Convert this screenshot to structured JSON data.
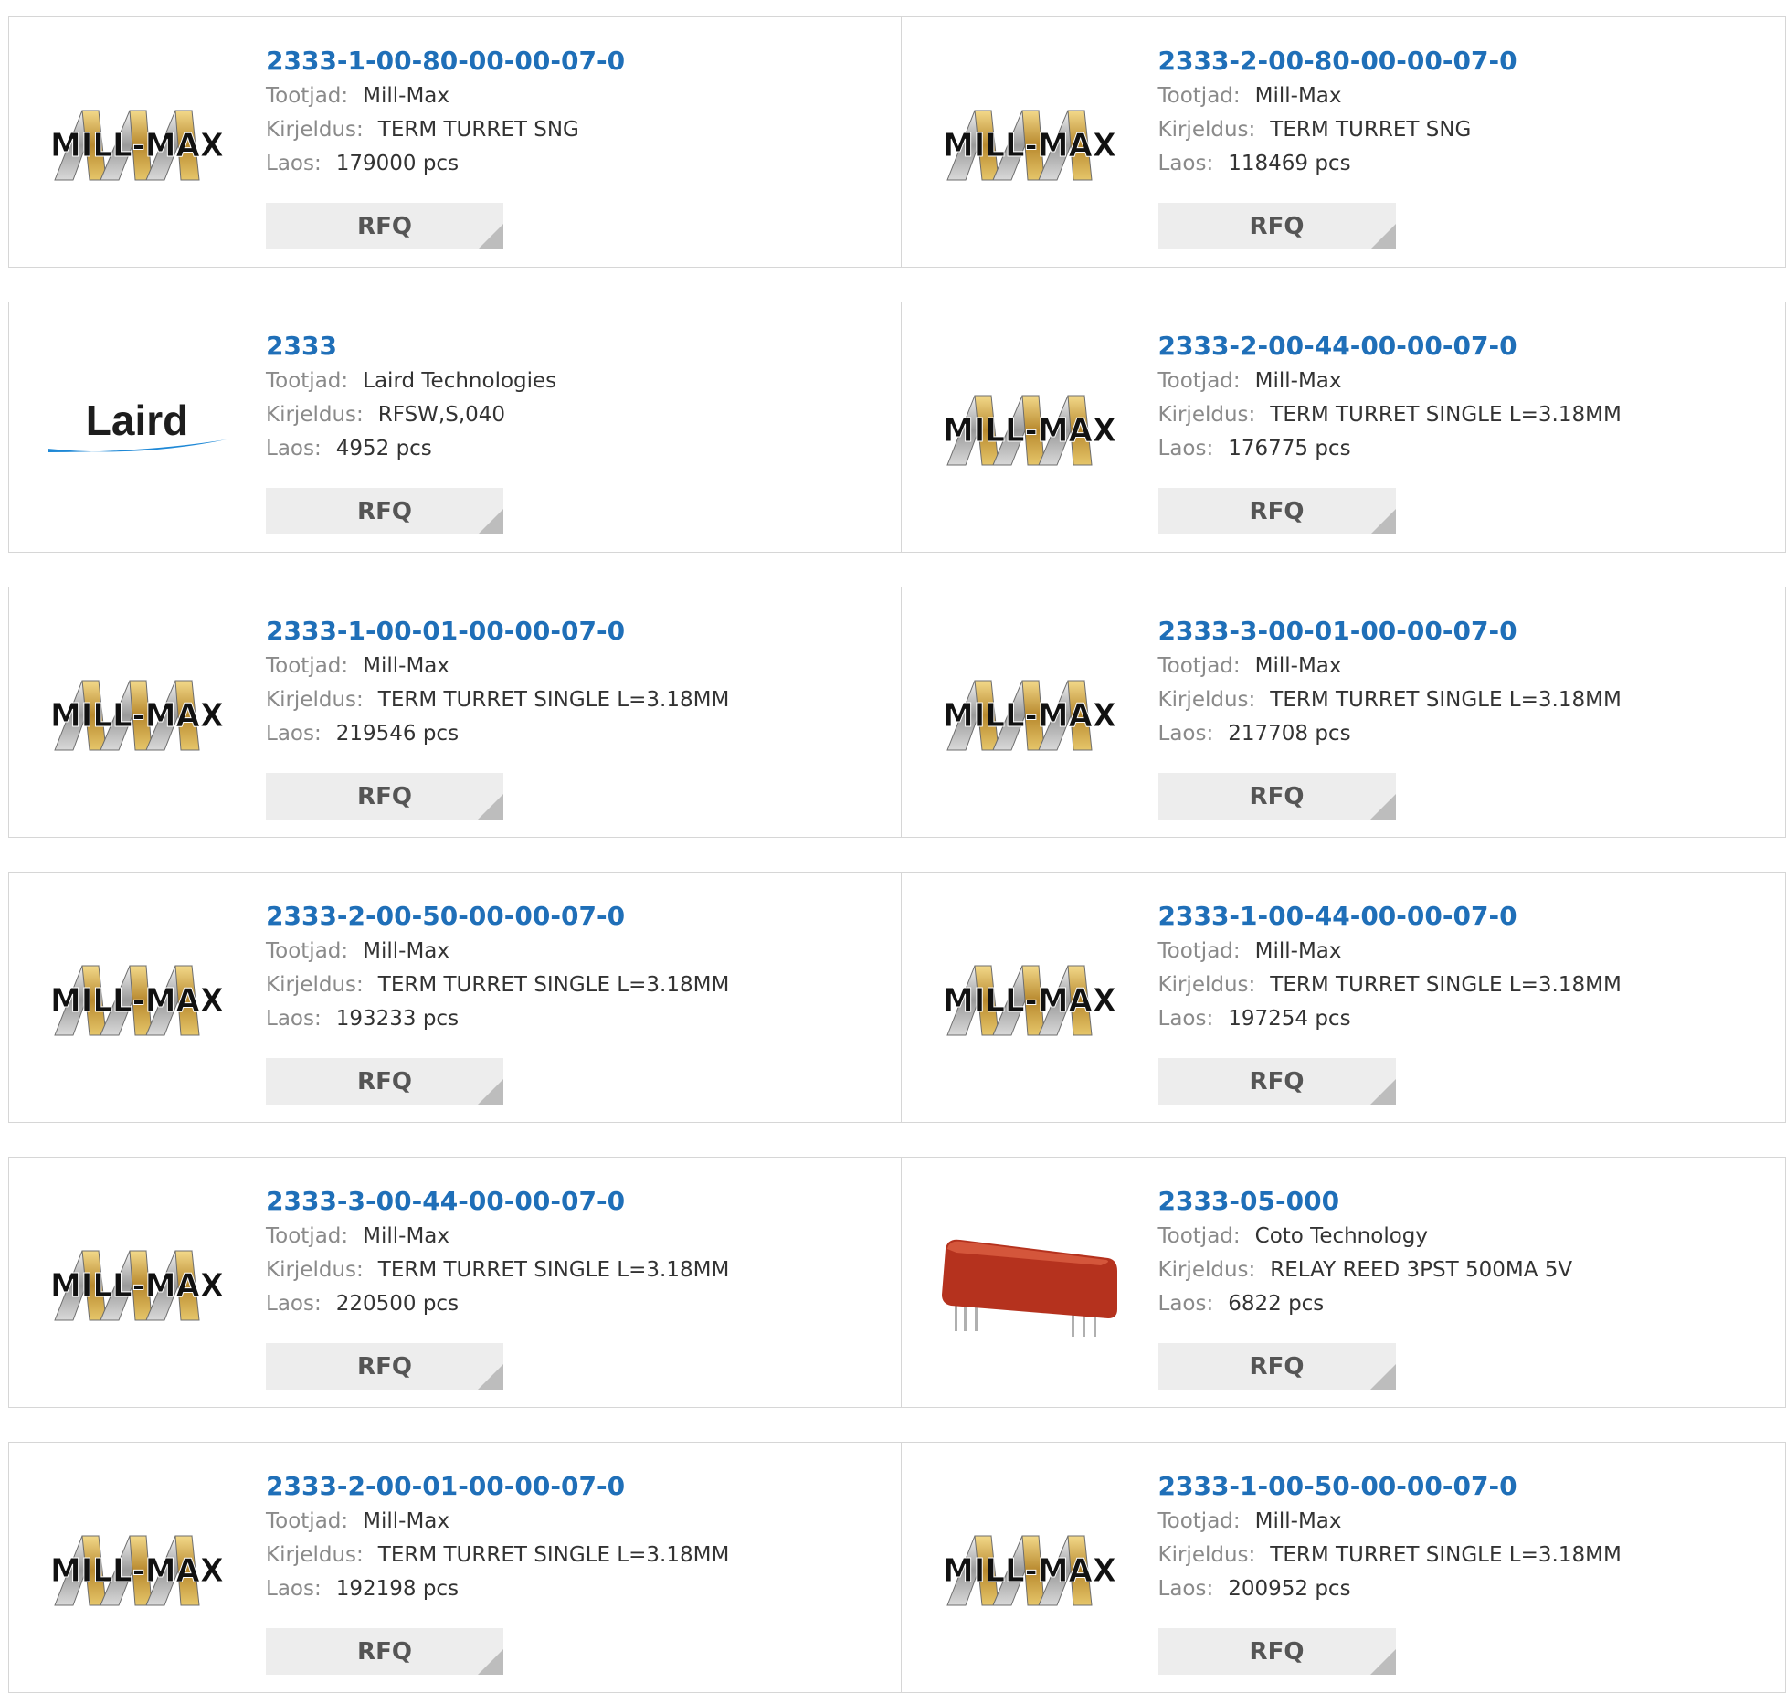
{
  "labels": {
    "maker": "Tootjad:",
    "desc": "Kirjeldus:",
    "stock": "Laos:",
    "rfq": "RFQ"
  },
  "products": [
    {
      "part": "2333-1-00-80-00-00-07-0",
      "maker": "Mill-Max",
      "desc": "TERM TURRET SNG",
      "stock": "179000 pcs",
      "logo": "millmax",
      "logo_text": "MILL-MAX"
    },
    {
      "part": "2333-2-00-80-00-00-07-0",
      "maker": "Mill-Max",
      "desc": "TERM TURRET SNG",
      "stock": "118469 pcs",
      "logo": "millmax",
      "logo_text": "MILL-MAX"
    },
    {
      "part": "2333",
      "maker": "Laird Technologies",
      "desc": "RFSW,S,040",
      "stock": "4952 pcs",
      "logo": "laird",
      "logo_text": "Laird"
    },
    {
      "part": "2333-2-00-44-00-00-07-0",
      "maker": "Mill-Max",
      "desc": "TERM TURRET SINGLE L=3.18MM",
      "stock": "176775 pcs",
      "logo": "millmax",
      "logo_text": "MILL-MAX"
    },
    {
      "part": "2333-1-00-01-00-00-07-0",
      "maker": "Mill-Max",
      "desc": "TERM TURRET SINGLE L=3.18MM",
      "stock": "219546 pcs",
      "logo": "millmax",
      "logo_text": "MILL-MAX"
    },
    {
      "part": "2333-3-00-01-00-00-07-0",
      "maker": "Mill-Max",
      "desc": "TERM TURRET SINGLE L=3.18MM",
      "stock": "217708 pcs",
      "logo": "millmax",
      "logo_text": "MILL-MAX"
    },
    {
      "part": "2333-2-00-50-00-00-07-0",
      "maker": "Mill-Max",
      "desc": "TERM TURRET SINGLE L=3.18MM",
      "stock": "193233 pcs",
      "logo": "millmax",
      "logo_text": "MILL-MAX"
    },
    {
      "part": "2333-1-00-44-00-00-07-0",
      "maker": "Mill-Max",
      "desc": "TERM TURRET SINGLE L=3.18MM",
      "stock": "197254 pcs",
      "logo": "millmax",
      "logo_text": "MILL-MAX"
    },
    {
      "part": "2333-3-00-44-00-00-07-0",
      "maker": "Mill-Max",
      "desc": "TERM TURRET SINGLE L=3.18MM",
      "stock": "220500 pcs",
      "logo": "millmax",
      "logo_text": "MILL-MAX"
    },
    {
      "part": "2333-05-000",
      "maker": "Coto Technology",
      "desc": "RELAY REED 3PST 500MA 5V",
      "stock": "6822 pcs",
      "logo": "relay",
      "logo_text": ""
    },
    {
      "part": "2333-2-00-01-00-00-07-0",
      "maker": "Mill-Max",
      "desc": "TERM TURRET SINGLE L=3.18MM",
      "stock": "192198 pcs",
      "logo": "millmax",
      "logo_text": "MILL-MAX"
    },
    {
      "part": "2333-1-00-50-00-00-07-0",
      "maker": "Mill-Max",
      "desc": "TERM TURRET SINGLE L=3.18MM",
      "stock": "200952 pcs",
      "logo": "millmax",
      "logo_text": "MILL-MAX"
    }
  ]
}
